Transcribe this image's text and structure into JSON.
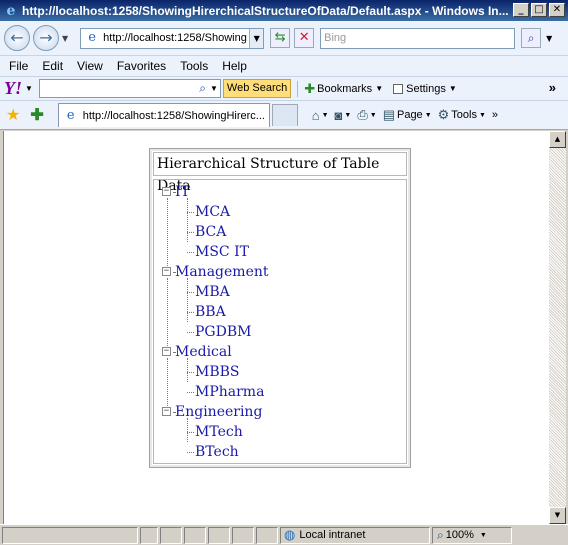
{
  "window": {
    "title": "http://localhost:1258/ShowingHirerchicalStructureOfData/Default.aspx - Windows In...",
    "min_glyph": "_",
    "max_glyph": "□",
    "close_glyph": "✕"
  },
  "address": {
    "url": "http://localhost:1258/Showing",
    "search_placeholder": "Bing"
  },
  "menu": [
    "File",
    "Edit",
    "View",
    "Favorites",
    "Tools",
    "Help"
  ],
  "yahoo": {
    "logo": "Y!",
    "web_search": "Web Search",
    "bookmarks": "Bookmarks",
    "settings": "Settings",
    "more": "»"
  },
  "tab": {
    "label": "http://localhost:1258/ShowingHirerc..."
  },
  "commands": {
    "page": "Page",
    "tools": "Tools",
    "more": "»"
  },
  "tree": {
    "heading": "Hierarchical Structure of Table Data",
    "groups": [
      {
        "label": "IT",
        "children": [
          "MCA",
          "BCA",
          "MSC IT"
        ]
      },
      {
        "label": "Management",
        "children": [
          "MBA",
          "BBA",
          "PGDBM"
        ]
      },
      {
        "label": "Medical",
        "children": [
          "MBBS",
          "MPharma"
        ]
      },
      {
        "label": "Engineering",
        "children": [
          "MTech",
          "BTech"
        ]
      }
    ]
  },
  "status": {
    "zone": "Local intranet",
    "zoom": "100%"
  }
}
